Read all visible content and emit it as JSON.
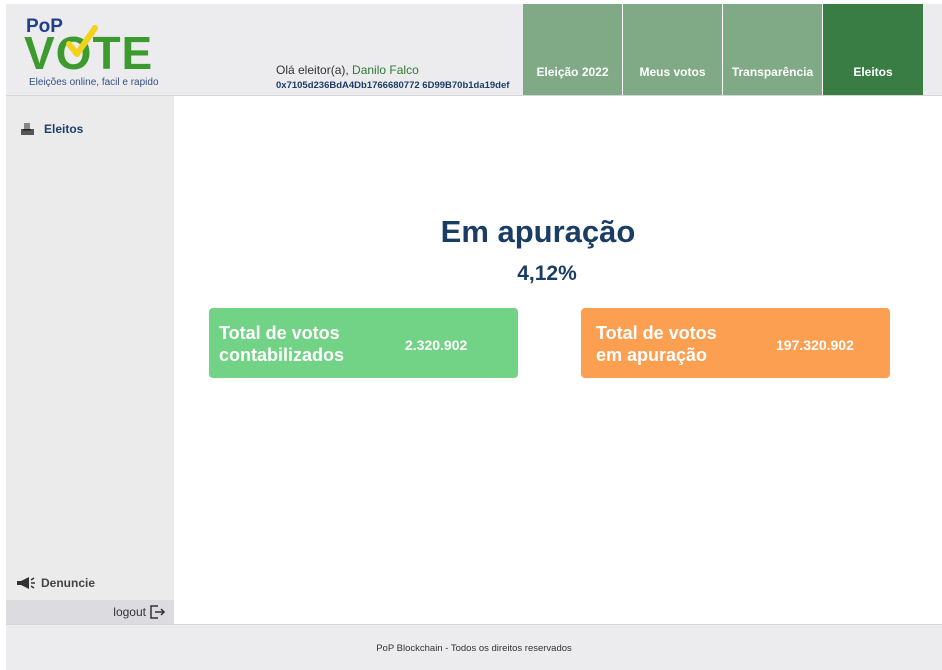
{
  "brand": {
    "pop": "PoP",
    "vote": "VOTE",
    "tagline": "Eleições online, facil e rapido"
  },
  "user": {
    "greeting": "Olá eleitor(a),",
    "name": "Danilo Falco",
    "address": "0x7105d236BdA4Db1766680772 6D99B70b1da19def"
  },
  "nav": {
    "tabs": [
      {
        "label": "Eleição 2022"
      },
      {
        "label": "Meus votos"
      },
      {
        "label": "Transparência"
      },
      {
        "label": "Eleitos"
      }
    ]
  },
  "sidebar": {
    "item": "Eleitos",
    "denuncie": "Denuncie",
    "logout": "logout"
  },
  "main": {
    "title": "Em apuração",
    "percent": "4,12%",
    "cards": [
      {
        "label_line1": "Total de votos",
        "label_line2": "contabilizados",
        "value": "2.320.902"
      },
      {
        "label_line1": "Total de votos",
        "label_line2": "em apuração",
        "value": "197.320.902"
      }
    ]
  },
  "footer": {
    "text": "PoP Blockchain - Todos os direitos reservados"
  },
  "colors": {
    "nav_tab": "#80aa85",
    "nav_active": "#3a7d44",
    "card_green": "#72d386",
    "card_orange": "#fd9f51",
    "title": "#1a3d66"
  },
  "icons": {
    "sidebar_item": "ballot-box-icon",
    "denuncie": "megaphone-icon",
    "logout": "logout-icon",
    "logo_check": "checkmark-icon"
  }
}
